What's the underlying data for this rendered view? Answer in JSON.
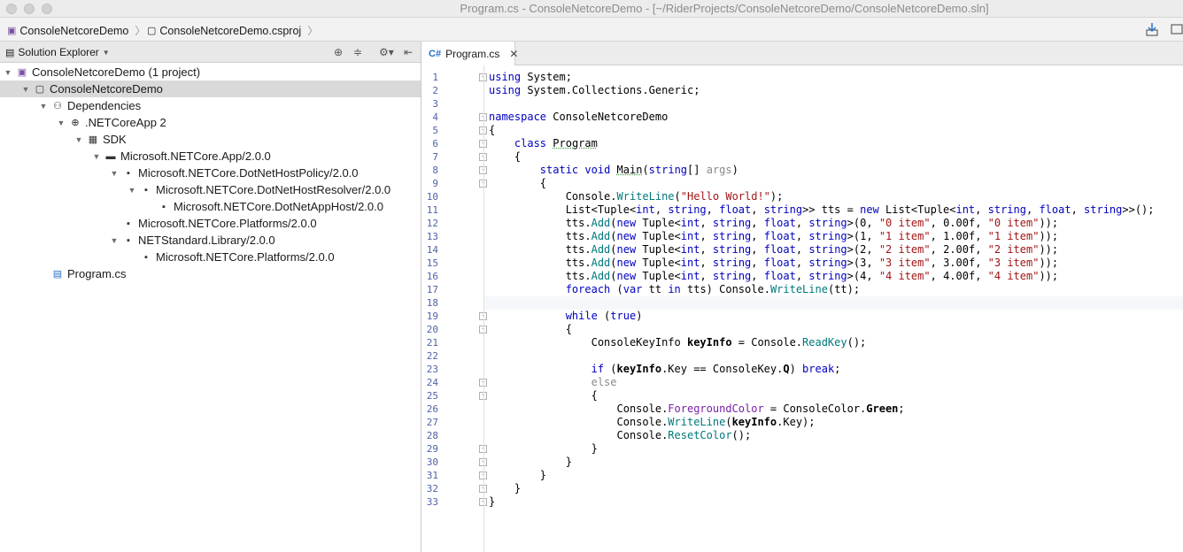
{
  "window": {
    "title": "Program.cs - ConsoleNetcoreDemo - [~/RiderProjects/ConsoleNetcoreDemo/ConsoleNetcoreDemo.sln]"
  },
  "breadcrumb": {
    "items": [
      "ConsoleNetcoreDemo",
      "ConsoleNetcoreDemo.csproj"
    ]
  },
  "solution_explorer": {
    "title": "Solution Explorer",
    "tree": [
      {
        "label": "ConsoleNetcoreDemo (1 project)",
        "level": 0,
        "expanded": true,
        "icon": "solution-icon"
      },
      {
        "label": "ConsoleNetcoreDemo",
        "level": 1,
        "expanded": true,
        "icon": "project-icon",
        "selected": true
      },
      {
        "label": "Dependencies",
        "level": 2,
        "expanded": true,
        "icon": "dependencies-icon"
      },
      {
        "label": ".NETCoreApp 2",
        "level": 3,
        "expanded": true,
        "icon": "framework-icon"
      },
      {
        "label": "SDK",
        "level": 4,
        "expanded": true,
        "icon": "sdk-icon"
      },
      {
        "label": "Microsoft.NETCore.App/2.0.0",
        "level": 5,
        "expanded": true,
        "icon": "package-icon"
      },
      {
        "label": "Microsoft.NETCore.DotNetHostPolicy/2.0.0",
        "level": 6,
        "expanded": true,
        "icon": "package-ref-icon"
      },
      {
        "label": "Microsoft.NETCore.DotNetHostResolver/2.0.0",
        "level": 7,
        "expanded": true,
        "icon": "package-ref-icon"
      },
      {
        "label": "Microsoft.NETCore.DotNetAppHost/2.0.0",
        "level": 8,
        "expanded": false,
        "icon": "package-ref-icon"
      },
      {
        "label": "Microsoft.NETCore.Platforms/2.0.0",
        "level": 6,
        "expanded": false,
        "icon": "package-ref-icon"
      },
      {
        "label": "NETStandard.Library/2.0.0",
        "level": 6,
        "expanded": true,
        "icon": "package-ref-icon"
      },
      {
        "label": "Microsoft.NETCore.Platforms/2.0.0",
        "level": 7,
        "expanded": false,
        "icon": "package-ref-icon"
      },
      {
        "label": "Program.cs",
        "level": 2,
        "expanded": false,
        "icon": "csharp-file-icon"
      }
    ]
  },
  "editor": {
    "tab_label": "Program.cs",
    "current_line": 18,
    "line_numbers": [
      "1",
      "2",
      "3",
      "4",
      "5",
      "6",
      "7",
      "8",
      "9",
      "10",
      "11",
      "12",
      "13",
      "14",
      "15",
      "16",
      "17",
      "18",
      "19",
      "20",
      "21",
      "22",
      "23",
      "24",
      "25",
      "26",
      "27",
      "28",
      "29",
      "30",
      "31",
      "32",
      "33"
    ],
    "lines": [
      "using System;",
      "using System.Collections.Generic;",
      "",
      "namespace ConsoleNetcoreDemo",
      "{",
      "    class Program",
      "    {",
      "        static void Main(string[] args)",
      "        {",
      "            Console.WriteLine(\"Hello World!\");",
      "            List<Tuple<int, string, float, string>> tts = new List<Tuple<int, string, float, string>>();",
      "            tts.Add(new Tuple<int, string, float, string>(0, \"0 item\", 0.00f, \"0 item\"));",
      "            tts.Add(new Tuple<int, string, float, string>(1, \"1 item\", 1.00f, \"1 item\"));",
      "            tts.Add(new Tuple<int, string, float, string>(2, \"2 item\", 2.00f, \"2 item\"));",
      "            tts.Add(new Tuple<int, string, float, string>(3, \"3 item\", 3.00f, \"3 item\"));",
      "            tts.Add(new Tuple<int, string, float, string>(4, \"4 item\", 4.00f, \"4 item\"));",
      "            foreach (var tt in tts) Console.WriteLine(tt);",
      "",
      "            while (true)",
      "            {",
      "                ConsoleKeyInfo keyInfo = Console.ReadKey();",
      "",
      "                if (keyInfo.Key == ConsoleKey.Q) break;",
      "                else",
      "                {",
      "                    Console.ForegroundColor = ConsoleColor.Green;",
      "                    Console.WriteLine(keyInfo.Key);",
      "                    Console.ResetColor();",
      "                }",
      "            }",
      "        }",
      "    }",
      "}"
    ]
  },
  "colors": {
    "keyword": "#0000c0",
    "string": "#a31515",
    "method": "#00787a",
    "property": "#7a1fa8",
    "line_number": "#4f63a8",
    "selection": "#d9d9d9"
  }
}
